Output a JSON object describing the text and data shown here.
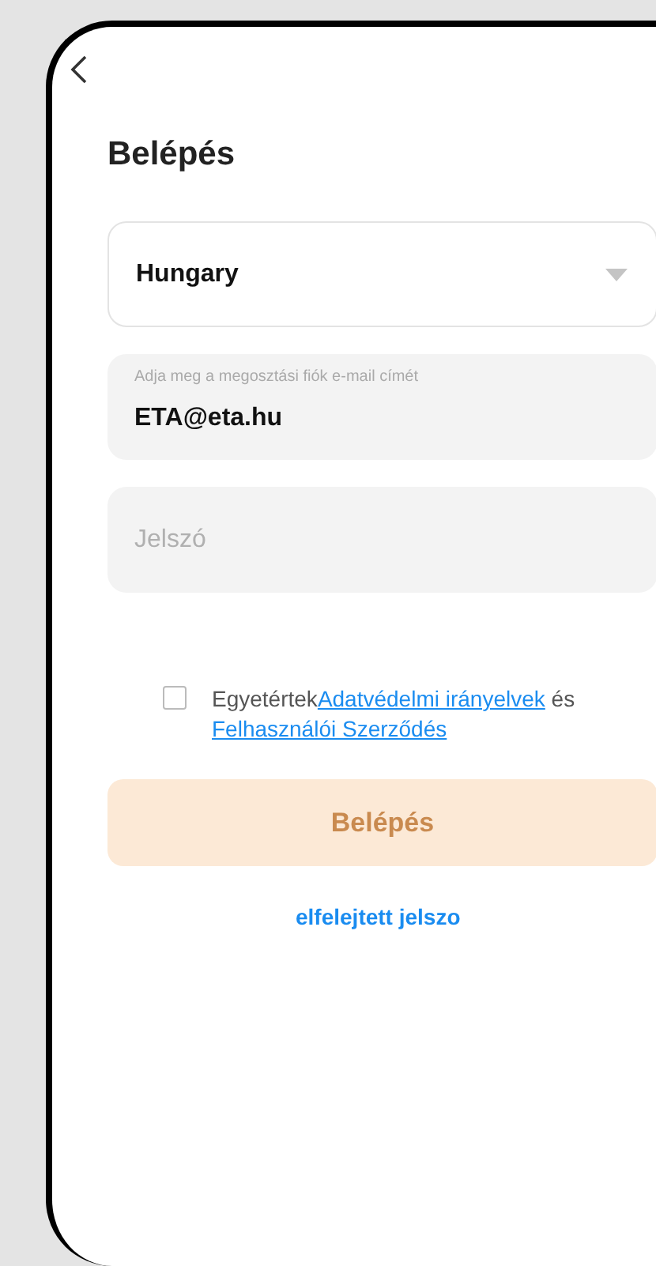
{
  "title": "Belépés",
  "country_select": {
    "value": "Hungary"
  },
  "email_field": {
    "label": "Adja meg a megosztási fiók e-mail címét",
    "value": "ETA@eta.hu"
  },
  "password_field": {
    "placeholder": "Jelszó"
  },
  "agreement": {
    "checked": false,
    "prefix": "Egyetértek",
    "privacy_link": "Adatvédelmi irányelvek",
    "conjunction": "és",
    "terms_link": "Felhasználói Szerződés"
  },
  "login_button": {
    "label": "Belépés",
    "disabled": true
  },
  "forgot_password_link": "elfelejtett jelszo"
}
